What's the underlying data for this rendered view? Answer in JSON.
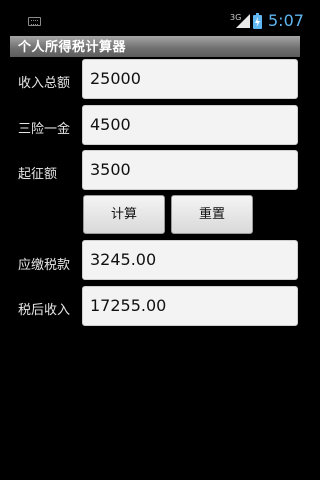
{
  "status_bar": {
    "network": "3G",
    "time": "5:07",
    "icons": [
      "keyboard-icon",
      "signal-icon",
      "battery-charging-icon"
    ]
  },
  "app": {
    "title": "个人所得税计算器"
  },
  "form": {
    "income": {
      "label": "收入总额",
      "value": "25000"
    },
    "insurance": {
      "label": "三险一金",
      "value": "4500"
    },
    "threshold": {
      "label": "起征额",
      "value": "3500"
    }
  },
  "buttons": {
    "calculate": "计算",
    "reset": "重置"
  },
  "results": {
    "tax_due": {
      "label": "应缴税款",
      "value": "3245.00"
    },
    "after_tax": {
      "label": "税后收入",
      "value": "17255.00"
    }
  },
  "colors": {
    "clock": "#5fb6f0",
    "title_bar": "#7a7a7a",
    "background": "#000000"
  }
}
